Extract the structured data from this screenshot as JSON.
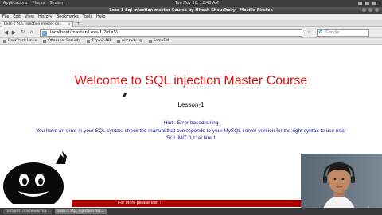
{
  "top_panel": {
    "menus": [
      "Applications",
      "Places",
      "System"
    ],
    "clock": "Tue Nov 26, 12:48 AM"
  },
  "window": {
    "title": "Less-1 Sql injection master Course by Hitesh Choudhary - Mozilla Firefox"
  },
  "menu_bar": [
    "File",
    "Edit",
    "View",
    "History",
    "Bookmarks",
    "Tools",
    "Help"
  ],
  "tab": {
    "label": "Less-1 SQL injection master co..."
  },
  "nav": {
    "url": "localhost/master/Less-1/?id=5\\",
    "search_placeholder": "Google"
  },
  "bookmarks": [
    "BackTrack Linux",
    "Offensive Security",
    "Exploit-DB",
    "Aircrack-ng",
    "SomaFM"
  ],
  "page": {
    "heading": "Welcome to SQL injection Master Course",
    "lesson": "Lesson-1",
    "hint": "Hint : Error based string",
    "error_line1": "You have an error in your SQL syntax; check the manual that corresponds to your MySQL server version for the right syntax to use near",
    "error_line2": "'5\\' LIMIT 0,1' at line 1"
  },
  "footer": {
    "text": "For more please visit :"
  },
  "webcam": {
    "watermark": "udemy"
  },
  "taskbar": {
    "items": [
      "root@bt: /var/www/ma...",
      "Less-1 SQL injection ma..."
    ]
  },
  "colors": {
    "heading": "#e01010",
    "hint_text": "#1a1a9a",
    "footer_bg": "#b00000"
  }
}
